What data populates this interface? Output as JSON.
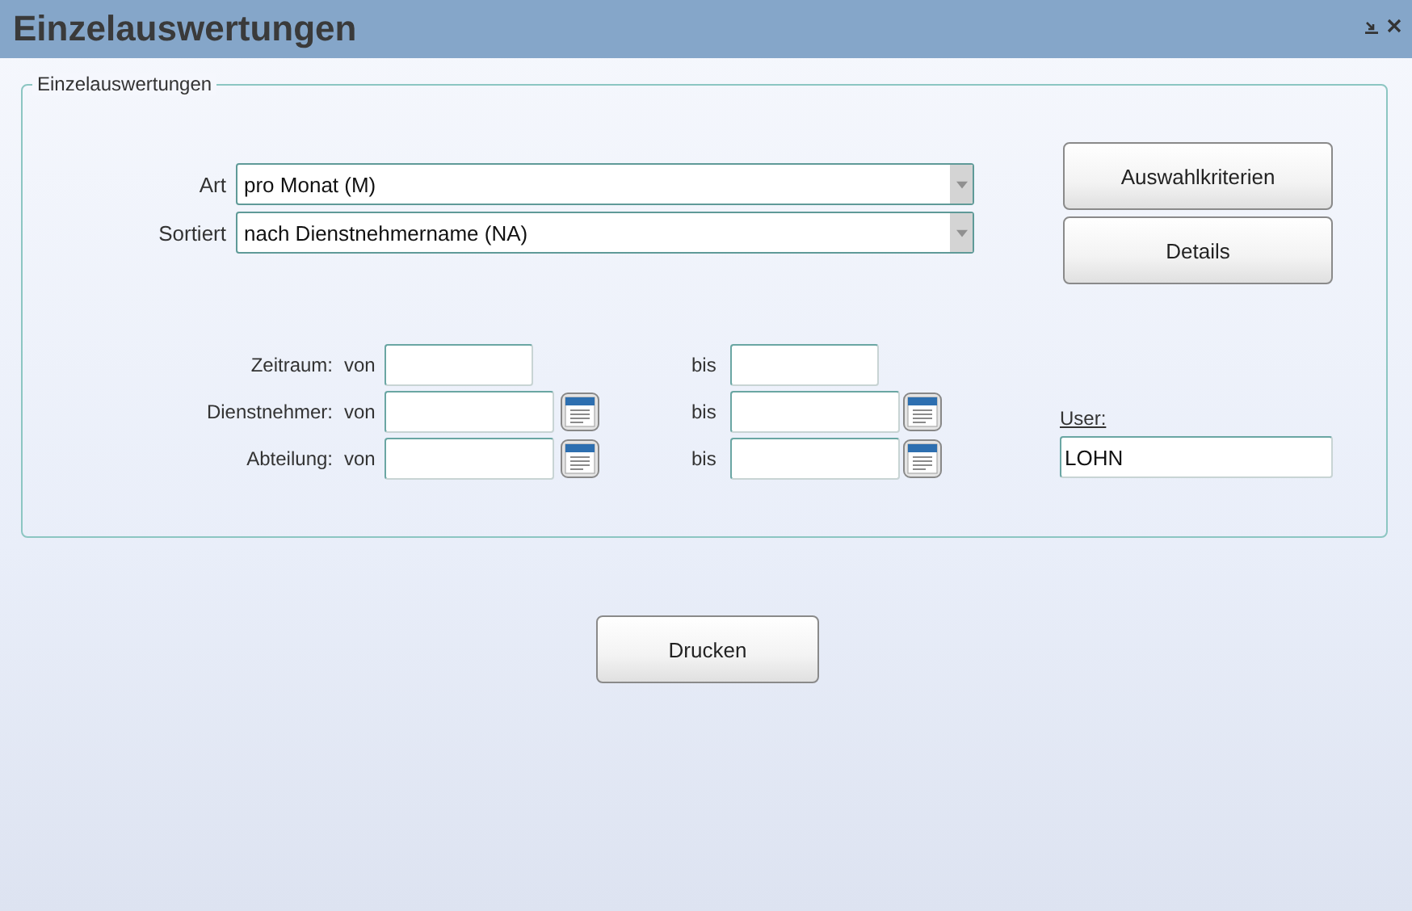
{
  "window": {
    "title": "Einzelauswertungen"
  },
  "group": {
    "legend": "Einzelauswertungen"
  },
  "selects": [
    {
      "label": "Art",
      "value": "pro Monat (M)"
    },
    {
      "label": "Sortiert",
      "value": "nach Dienstnehmername (NA)"
    }
  ],
  "side_buttons": [
    "Auswahlkriterien",
    "Details"
  ],
  "ranges": [
    {
      "label": "Zeitraum:",
      "from_label": "von",
      "to_label": "bis",
      "picker": false
    },
    {
      "label": "Dienstnehmer:",
      "from_label": "von",
      "to_label": "bis",
      "picker": true
    },
    {
      "label": "Abteilung:",
      "from_label": "von",
      "to_label": "bis",
      "picker": true
    }
  ],
  "user": {
    "label": "User:",
    "value": "LOHN"
  },
  "print_button": "Drucken"
}
